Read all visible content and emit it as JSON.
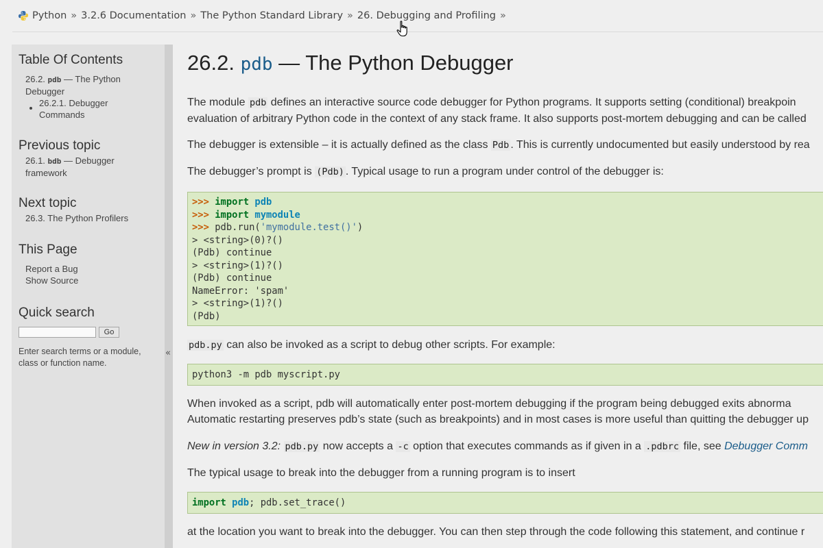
{
  "breadcrumb": {
    "items": [
      "Python",
      "3.2.6 Documentation",
      "The Python Standard Library",
      "26. Debugging and Profiling"
    ],
    "separator": "»"
  },
  "sidebar": {
    "toc_heading": "Table Of Contents",
    "toc_item1_prefix": "26.2. ",
    "toc_item1_code": "pdb",
    "toc_item1_suffix": " — The Python",
    "toc_item1_line2": "Debugger",
    "toc_sub1_line1": "26.2.1. Debugger",
    "toc_sub1_line2": "Commands",
    "prev_heading": "Previous topic",
    "prev_prefix": "26.1. ",
    "prev_code": "bdb",
    "prev_suffix": " — Debugger",
    "prev_line2": "framework",
    "next_heading": "Next topic",
    "next_link": "26.3. The Python Profilers",
    "this_page_heading": "This Page",
    "report_bug": "Report a Bug",
    "show_source": "Show Source",
    "search_heading": "Quick search",
    "search_value": "",
    "go_label": "Go",
    "search_help": "Enter search terms or a module, class or function name.",
    "collapse_label": "«"
  },
  "main": {
    "title_prefix": "26.2. ",
    "title_code": "pdb",
    "title_suffix": " — The Python Debugger",
    "p1_l1a": "The module ",
    "p1_l1code": "pdb",
    "p1_l1b": " defines an interactive source code debugger for Python programs. It supports setting (conditional) breakpoin",
    "p1_l2": "evaluation of arbitrary Python code in the context of any stack frame. It also supports post-mortem debugging and can be called",
    "p2a": "The debugger is extensible – it is actually defined as the class ",
    "p2code": "Pdb",
    "p2b": ". This is currently undocumented but easily understood by rea",
    "p3a": "The debugger’s prompt is ",
    "p3code": "(Pdb)",
    "p3b": ". Typical usage to run a program under control of the debugger is:",
    "code1": {
      "l1_prompt": ">>>",
      "l1_kw": "import",
      "l1_mod": "pdb",
      "l2_prompt": ">>>",
      "l2_kw": "import",
      "l2_mod": "mymodule",
      "l3_prompt": ">>>",
      "l3_pre": "pdb.run(",
      "l3_str": "'mymodule.test()'",
      "l3_post": ")",
      "l4": "> <string>(0)?()",
      "l5": "(Pdb) continue",
      "l6": "> <string>(1)?()",
      "l7": "(Pdb) continue",
      "l8": "NameError: 'spam'",
      "l9": "> <string>(1)?()",
      "l10": "(Pdb)"
    },
    "p4code": "pdb.py",
    "p4": " can also be invoked as a script to debug other scripts. For example:",
    "code2": "python3 -m pdb myscript.py",
    "p5_l1": "When invoked as a script, pdb will automatically enter post-mortem debugging if the program being debugged exits abnorma",
    "p5_l2": "Automatic restarting preserves pdb’s state (such as breakpoints) and in most cases is more useful than quitting the debugger up",
    "p6_italic": "New in version 3.2: ",
    "p6_code1": "pdb.py",
    "p6_a": " now accepts a ",
    "p6_code2": "-c",
    "p6_b": " option that executes commands as if given in a ",
    "p6_code3": ".pdbrc",
    "p6_c": " file, see ",
    "p6_link": "Debugger Comm",
    "p7": "The typical usage to break into the debugger from a running program is to insert",
    "code3": {
      "kw": "import",
      "mod": "pdb",
      "rest": "; pdb.set_trace()"
    },
    "p8": "at the location you want to break into the debugger. You can then step through the code following this statement, and continue r"
  },
  "icons": {
    "logo": "python-logo-icon",
    "cursor": "hand-pointer-cursor-icon"
  }
}
